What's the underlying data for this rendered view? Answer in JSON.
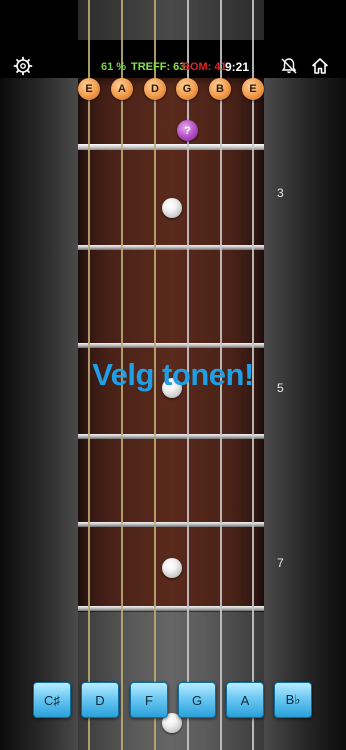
{
  "status": {
    "percent": "61 %",
    "treff": "TREFF: 63",
    "bom": "BOM: 41",
    "time": "9:21"
  },
  "open_strings": [
    "E",
    "A",
    "D",
    "G",
    "B",
    "E"
  ],
  "question_marker": "?",
  "fret_numbers": {
    "three": "3",
    "five": "5",
    "seven": "7"
  },
  "prompt": "Velg tonen!",
  "answers": [
    "C♯",
    "D",
    "F",
    "G",
    "A",
    "B♭"
  ],
  "icons": {
    "settings": "settings-icon",
    "silent": "bell-off-icon",
    "home": "home-icon"
  },
  "colors": {
    "prompt": "#1e9fe6",
    "percent": "#7bd14a",
    "bom": "#e02525",
    "open_note": "#f19a4a",
    "question_marker": "#b04bc0",
    "answer_button": "#6cc8f2"
  }
}
